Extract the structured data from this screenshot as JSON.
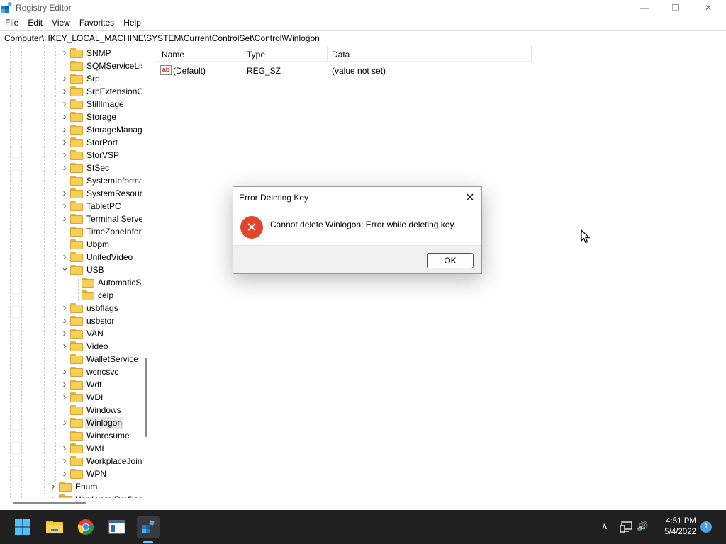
{
  "window": {
    "title": "Registry Editor",
    "controls": {
      "minimize": "—",
      "maximize": "❐",
      "close": "✕"
    }
  },
  "menu": [
    "File",
    "Edit",
    "View",
    "Favorites",
    "Help"
  ],
  "address": "Computer\\HKEY_LOCAL_MACHINE\\SYSTEM\\CurrentControlSet\\Control\\Winlogon",
  "tree": {
    "items": [
      {
        "label": "SNMP",
        "expandable": true,
        "level": 2
      },
      {
        "label": "SQMServiceList",
        "expandable": false,
        "level": 2
      },
      {
        "label": "Srp",
        "expandable": true,
        "level": 2
      },
      {
        "label": "SrpExtensionConfig",
        "expandable": true,
        "level": 2
      },
      {
        "label": "StillImage",
        "expandable": true,
        "level": 2
      },
      {
        "label": "Storage",
        "expandable": true,
        "level": 2
      },
      {
        "label": "StorageManagement",
        "expandable": true,
        "level": 2
      },
      {
        "label": "StorPort",
        "expandable": true,
        "level": 2
      },
      {
        "label": "StorVSP",
        "expandable": true,
        "level": 2
      },
      {
        "label": "StSec",
        "expandable": true,
        "level": 2
      },
      {
        "label": "SystemInformation",
        "expandable": false,
        "level": 2
      },
      {
        "label": "SystemResources",
        "expandable": true,
        "level": 2
      },
      {
        "label": "TabletPC",
        "expandable": true,
        "level": 2
      },
      {
        "label": "Terminal Server",
        "expandable": true,
        "level": 2
      },
      {
        "label": "TimeZoneInformation",
        "expandable": false,
        "level": 2
      },
      {
        "label": "Ubpm",
        "expandable": false,
        "level": 2
      },
      {
        "label": "UnitedVideo",
        "expandable": true,
        "level": 2
      },
      {
        "label": "USB",
        "expandable": true,
        "expanded": true,
        "level": 2
      },
      {
        "label": "AutomaticSurpriseRemoval",
        "expandable": false,
        "level": 3
      },
      {
        "label": "ceip",
        "expandable": false,
        "level": 3
      },
      {
        "label": "usbflags",
        "expandable": true,
        "level": 2
      },
      {
        "label": "usbstor",
        "expandable": true,
        "level": 2
      },
      {
        "label": "VAN",
        "expandable": true,
        "level": 2
      },
      {
        "label": "Video",
        "expandable": true,
        "level": 2
      },
      {
        "label": "WalletService",
        "expandable": false,
        "level": 2
      },
      {
        "label": "wcncsvc",
        "expandable": true,
        "level": 2
      },
      {
        "label": "Wdf",
        "expandable": true,
        "level": 2
      },
      {
        "label": "WDI",
        "expandable": true,
        "level": 2
      },
      {
        "label": "Windows",
        "expandable": false,
        "level": 2
      },
      {
        "label": "Winlogon",
        "expandable": true,
        "level": 2,
        "selected": true
      },
      {
        "label": "Winresume",
        "expandable": false,
        "level": 2
      },
      {
        "label": "WMI",
        "expandable": true,
        "level": 2
      },
      {
        "label": "WorkplaceJoin",
        "expandable": true,
        "level": 2
      },
      {
        "label": "WPN",
        "expandable": true,
        "level": 2
      },
      {
        "label": "Enum",
        "expandable": true,
        "level": 1
      },
      {
        "label": "Hardware Profiles",
        "expandable": true,
        "level": 1
      }
    ]
  },
  "list": {
    "columns": [
      "Name",
      "Type",
      "Data"
    ],
    "rows": [
      {
        "name": "(Default)",
        "type": "REG_SZ",
        "data": "(value not set)",
        "icon": "ab"
      }
    ]
  },
  "dialog": {
    "title": "Error Deleting Key",
    "close": "✕",
    "icon": "error-icon",
    "icon_glyph": "✕",
    "message": "Cannot delete Winlogon:  Error while deleting key.",
    "ok_label": "OK"
  },
  "taskbar": {
    "time": "4:51 PM",
    "date": "5/4/2022",
    "notification_count": "1",
    "tray": {
      "chevron": "∧",
      "speaker": "🔊"
    }
  },
  "colors": {
    "accent": "#0067c0",
    "error": "#e0462b",
    "folder": "#f5cf57",
    "taskbar": "#202020"
  }
}
